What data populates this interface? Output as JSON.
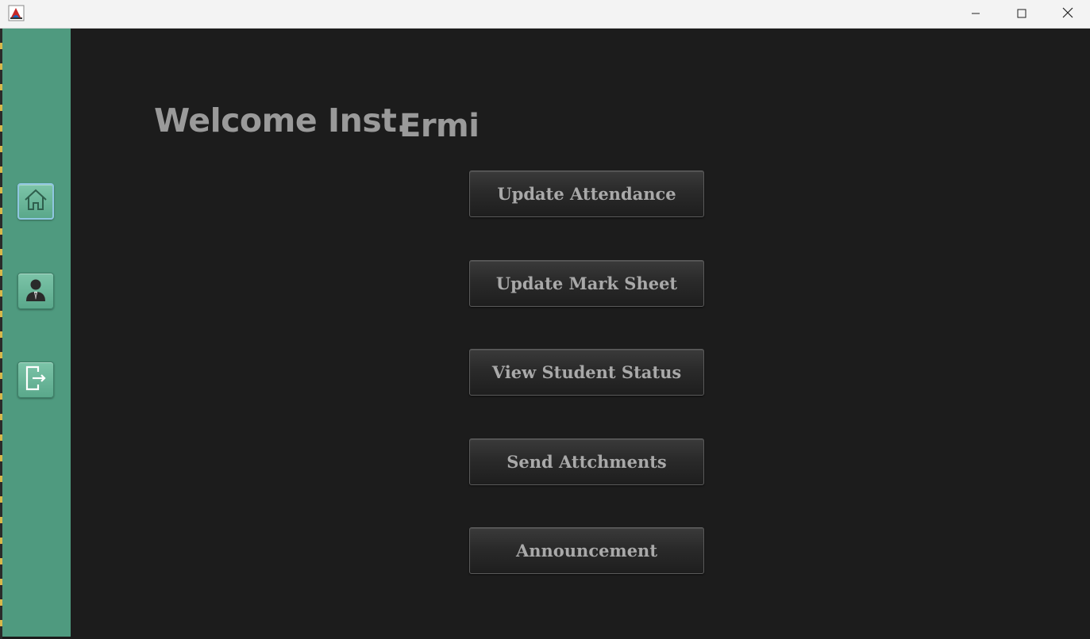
{
  "window": {
    "icons": {
      "app": "java-app-icon",
      "minimize": "minimize-icon",
      "maximize": "maximize-icon",
      "close": "close-icon"
    }
  },
  "sidebar": {
    "items": [
      {
        "name": "home",
        "icon": "home-icon"
      },
      {
        "name": "profile",
        "icon": "user-profile-icon"
      },
      {
        "name": "logout",
        "icon": "logout-icon"
      }
    ],
    "accent": "#4f9a7f"
  },
  "main": {
    "welcome_text": "Welcome Inst.",
    "username": "Ermi",
    "buttons": [
      {
        "label": "Update Attendance"
      },
      {
        "label": "Update Mark Sheet"
      },
      {
        "label": "View Student Status"
      },
      {
        "label": "Send Attchments"
      },
      {
        "label": "Announcement"
      }
    ]
  }
}
